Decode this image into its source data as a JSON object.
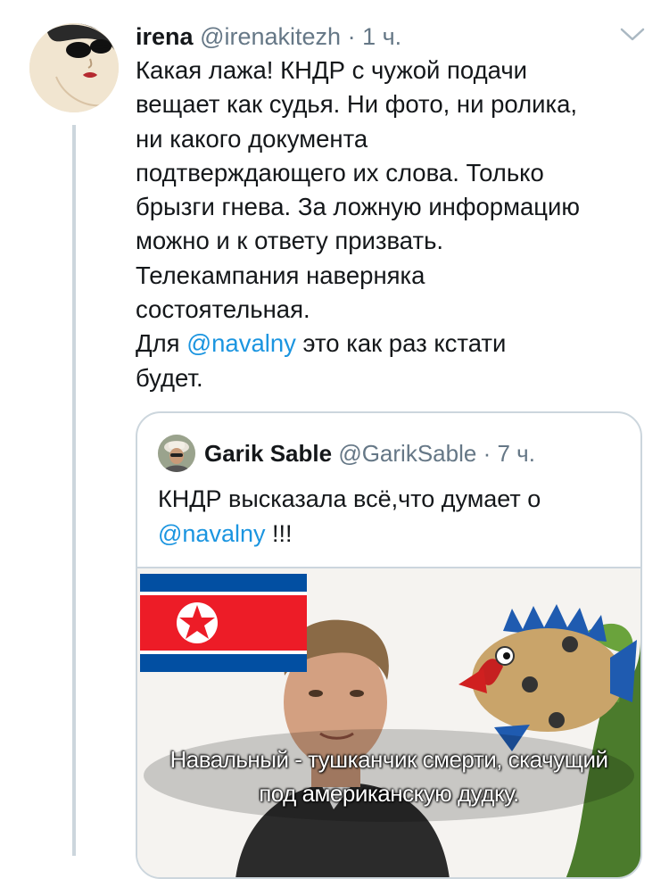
{
  "tweet": {
    "display_name": "irena",
    "handle": "@irenakitezh",
    "separator": "·",
    "time": "1 ч.",
    "text_part1": "Какая лажа! КНДР с чужой подачи\nвещает как судья. Ни фото, ни ролика,\nни какого документа\nподтверждающего их слова. Только\nбрызги гнева. За ложную информацию\nможно и к ответу призвать.\nТелекампания наверняка\nсостоятельная.\nДля ",
    "mention": "@navalny",
    "text_part2": "  это как раз кстати\nбудет.",
    "avatar_icon": "woman-sunglasses-avatar-icon",
    "menu_icon": "chevron-down-icon"
  },
  "quoted": {
    "display_name": "Garik Sable",
    "handle": "@GarikSable",
    "separator": "·",
    "time": "7 ч.",
    "text_part1": "КНДР высказала всё,что думает о\n",
    "mention": "@navalny",
    "text_part2": "  !!!",
    "avatar_icon": "man-hat-avatar-icon",
    "media": {
      "flag_icon": "north-korea-flag-icon",
      "subtitle_line1": "Навальный - тушканчик смерти, скачущий",
      "subtitle_line2": "под американскую дудку."
    }
  },
  "colors": {
    "text": "#14171a",
    "secondary": "#657786",
    "link": "#1b95e0",
    "border": "#ccd6dd",
    "flag_blue": "#024fa2",
    "flag_red": "#ed1c27"
  }
}
